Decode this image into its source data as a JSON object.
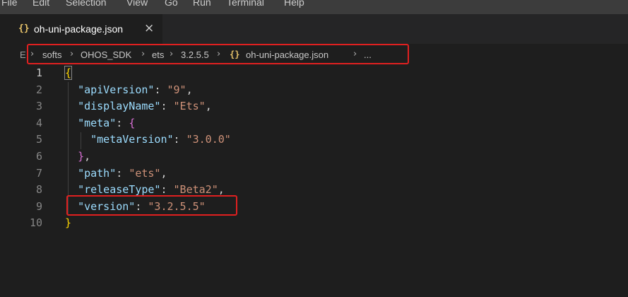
{
  "menubar": {
    "items": [
      "File",
      "Edit",
      "Selection",
      "View",
      "Go",
      "Run",
      "Terminal",
      "Help"
    ]
  },
  "tab": {
    "icon": "json-braces-icon",
    "label": "oh-uni-package.json",
    "close": "×"
  },
  "breadcrumb": {
    "leading": "E",
    "items": [
      "softs",
      "OHOS_SDK",
      "ets",
      "3.2.5.5",
      "oh-uni-package.json",
      "..."
    ],
    "file_icon": "json-braces-icon",
    "highlight_color": "#e02020"
  },
  "editor": {
    "active_line": 1,
    "line_numbers": [
      "1",
      "2",
      "3",
      "4",
      "5",
      "6",
      "7",
      "8",
      "9",
      "10"
    ],
    "lines": [
      [
        {
          "t": "{",
          "c": "b1"
        }
      ],
      [
        {
          "t": "  "
        },
        {
          "t": "\"apiVersion\"",
          "c": "k"
        },
        {
          "t": ": "
        },
        {
          "t": "\"9\"",
          "c": "s"
        },
        {
          "t": ","
        }
      ],
      [
        {
          "t": "  "
        },
        {
          "t": "\"displayName\"",
          "c": "k"
        },
        {
          "t": ": "
        },
        {
          "t": "\"Ets\"",
          "c": "s"
        },
        {
          "t": ","
        }
      ],
      [
        {
          "t": "  "
        },
        {
          "t": "\"meta\"",
          "c": "k"
        },
        {
          "t": ": "
        },
        {
          "t": "{",
          "c": "b2"
        }
      ],
      [
        {
          "t": "    "
        },
        {
          "t": "\"metaVersion\"",
          "c": "k"
        },
        {
          "t": ": "
        },
        {
          "t": "\"3.0.0\"",
          "c": "s"
        }
      ],
      [
        {
          "t": "  "
        },
        {
          "t": "}",
          "c": "b2"
        },
        {
          "t": ","
        }
      ],
      [
        {
          "t": "  "
        },
        {
          "t": "\"path\"",
          "c": "k"
        },
        {
          "t": ": "
        },
        {
          "t": "\"ets\"",
          "c": "s"
        },
        {
          "t": ","
        }
      ],
      [
        {
          "t": "  "
        },
        {
          "t": "\"releaseType\"",
          "c": "k"
        },
        {
          "t": ": "
        },
        {
          "t": "\"Beta2\"",
          "c": "s"
        },
        {
          "t": ","
        }
      ],
      [
        {
          "t": "  "
        },
        {
          "t": "\"version\"",
          "c": "k"
        },
        {
          "t": ": "
        },
        {
          "t": "\"3.2.5.5\"",
          "c": "s"
        }
      ],
      [
        {
          "t": "}",
          "c": "b1"
        }
      ]
    ],
    "highlighted_line": 9,
    "colors": {
      "key": "#9cdcfe",
      "string": "#ce9178",
      "bracket_outer": "#ffd700",
      "bracket_inner": "#da70d6",
      "background": "#1e1e1e"
    }
  }
}
